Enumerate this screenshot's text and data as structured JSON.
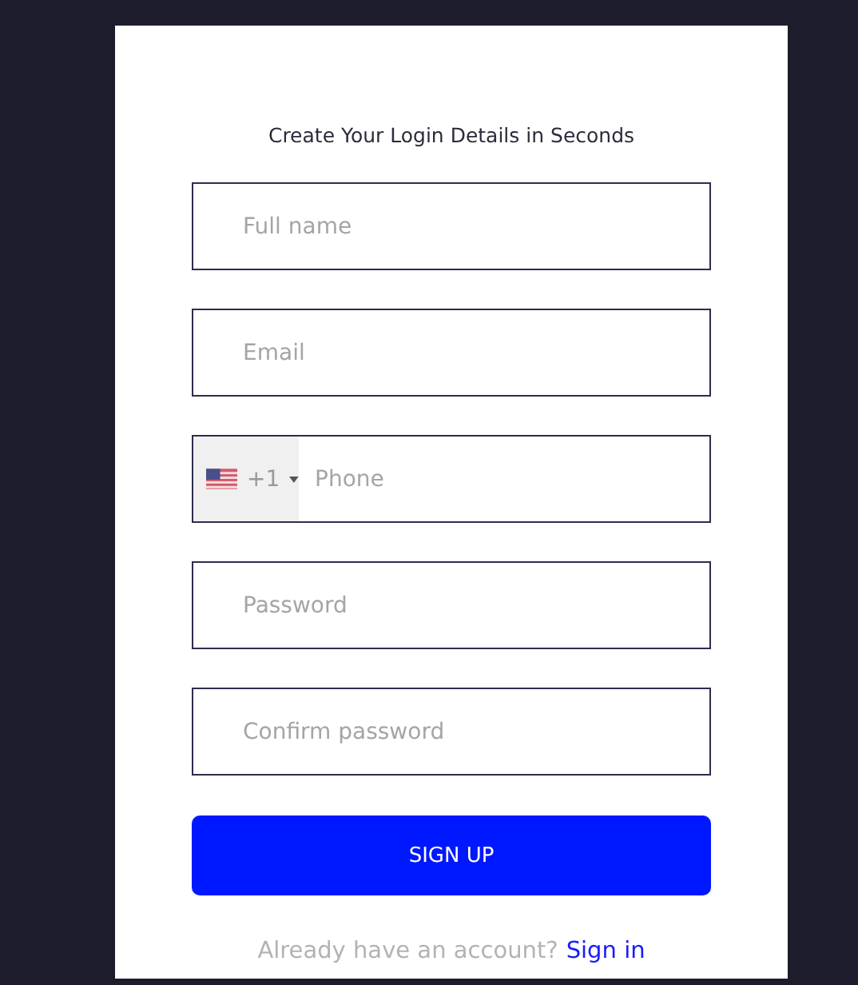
{
  "title": "Create Your Login Details in Seconds",
  "fields": [
    {
      "kind": "text",
      "placeholder": "Full name"
    },
    {
      "kind": "text",
      "placeholder": "Email"
    },
    {
      "kind": "phone",
      "dial_code": "+1",
      "placeholder": "Phone"
    },
    {
      "kind": "text",
      "placeholder": "Password"
    },
    {
      "kind": "text",
      "placeholder": "Confirm password"
    }
  ],
  "submit_button": "SIGN UP",
  "footer": {
    "prompt": "Already have an account?",
    "link": "Sign in"
  }
}
